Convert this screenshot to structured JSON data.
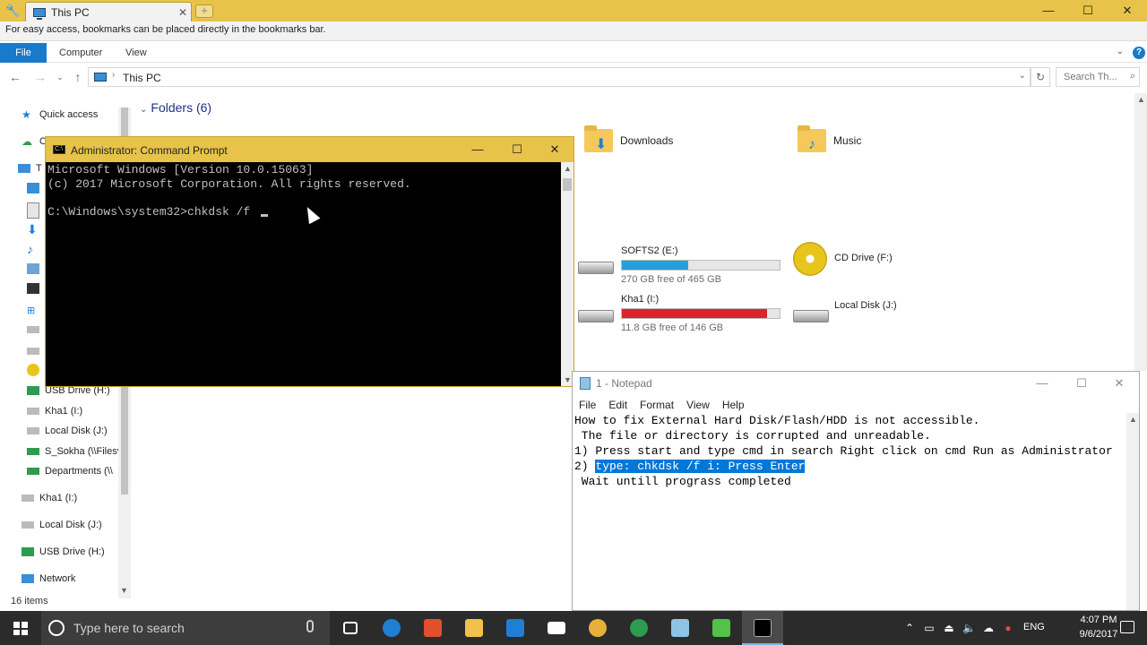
{
  "browser": {
    "tab_title": "This PC",
    "tab_close": "✕",
    "new_tab": "+",
    "menu_icon": "wrench-icon",
    "bookmarks_message": "For easy access, bookmarks can be placed directly in the bookmarks bar.",
    "controls": {
      "minimize": "—",
      "maximize": "☐",
      "close": "✕"
    }
  },
  "explorer": {
    "ribbon": {
      "file": "File",
      "tabs": [
        "Computer",
        "View"
      ],
      "help": "?"
    },
    "address": {
      "path": "This PC"
    },
    "search": {
      "placeholder": "Search Th..."
    },
    "nav": {
      "items": [
        "Quick access",
        "O",
        "T",
        "USB Drive (H:)",
        "Kha1 (I:)",
        "Local Disk (J:)",
        "S_Sokha (\\\\Filesv",
        "Departments (\\\\",
        "Kha1 (I:)",
        "Local Disk (J:)",
        "USB Drive (H:)",
        "Network"
      ]
    },
    "status": {
      "items_count": "16 items"
    },
    "folders": {
      "header": "Folders (6)",
      "visible": [
        {
          "name": "Downloads",
          "badge": "⬇",
          "badge_color": "#1e7fd4"
        },
        {
          "name": "Music",
          "badge": "♪",
          "badge_color": "#1e7fd4"
        }
      ]
    },
    "drives": [
      {
        "name": "SOFTS2 (E:)",
        "free": "270 GB free of 465 GB",
        "used_fraction": 0.42,
        "bar_color": "#26a0da"
      },
      {
        "name": "CD Drive (F:)"
      },
      {
        "name": "Kha1 (I:)",
        "free": "11.8 GB free of 146 GB",
        "used_fraction": 0.92,
        "bar_color": "#da2626"
      },
      {
        "name": "Local Disk (J:)"
      }
    ]
  },
  "cmd": {
    "title": "Administrator: Command Prompt",
    "line1": "Microsoft Windows [Version 10.0.15063]",
    "line2": "(c) 2017 Microsoft Corporation. All rights reserved.",
    "line3": "",
    "prompt": "C:\\Windows\\system32>chkdsk /f "
  },
  "notepad": {
    "title": "1 - Notepad",
    "menu": [
      "File",
      "Edit",
      "Format",
      "View",
      "Help"
    ],
    "lines": [
      "How to fix External Hard Disk/Flash/HDD is not accessible.",
      " The file or directory is corrupted and unreadable.",
      "1) Press start and type cmd in search Right click on cmd Run as Administrator",
      "2) ",
      " Wait untill prograss completed"
    ],
    "selected_text": "type: chkdsk /f i: Press Enter"
  },
  "taskbar": {
    "search_placeholder": "Type here to search",
    "language": "ENG",
    "time": "4:07 PM",
    "date": "9/6/2017",
    "apps": [
      {
        "name": "task-view-icon",
        "color": "#2b2b2b"
      },
      {
        "name": "edge-icon",
        "color": "#1e7fd4"
      },
      {
        "name": "app-red-icon",
        "color": "#e0502c"
      },
      {
        "name": "file-explorer-icon",
        "color": "#f1c14b"
      },
      {
        "name": "store-icon",
        "color": "#1e7fd4"
      },
      {
        "name": "mail-icon",
        "color": "#ffffff"
      },
      {
        "name": "chrome-icon",
        "color": "#e8b03a"
      },
      {
        "name": "globe-app-icon",
        "color": "#2e9b4f"
      },
      {
        "name": "notepad-app-icon",
        "color": "#8fc3e6"
      },
      {
        "name": "clover-app-icon",
        "color": "#53c24a"
      },
      {
        "name": "cmd-app-icon",
        "color": "#000000"
      }
    ]
  }
}
